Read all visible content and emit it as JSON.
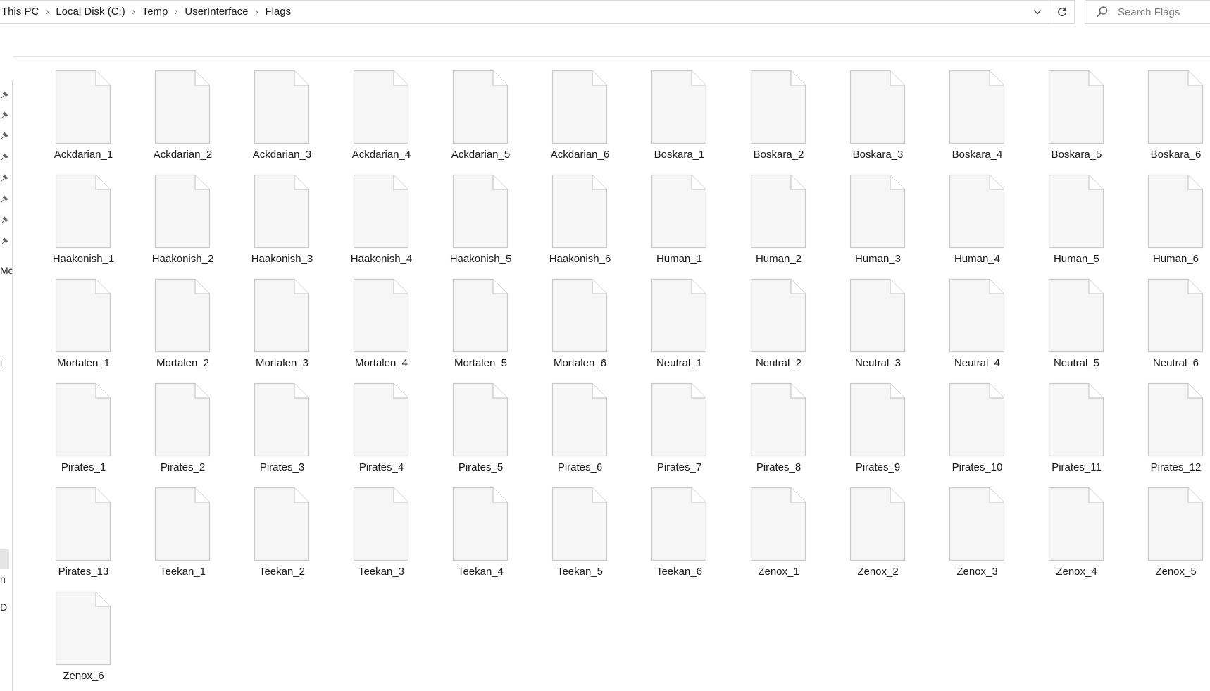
{
  "breadcrumb": [
    "This PC",
    "Local Disk (C:)",
    "Temp",
    "UserInterface",
    "Flags"
  ],
  "search": {
    "placeholder": "Search Flags",
    "value": ""
  },
  "nav_fragments": [
    "Mc",
    "l",
    "n",
    "D"
  ],
  "icons": {
    "dropdown": "chevron-down-icon",
    "refresh": "refresh-icon",
    "search": "search-icon",
    "file": "blank-file-icon",
    "pin": "pin-icon"
  },
  "files": [
    "Ackdarian_1",
    "Ackdarian_2",
    "Ackdarian_3",
    "Ackdarian_4",
    "Ackdarian_5",
    "Ackdarian_6",
    "Boskara_1",
    "Boskara_2",
    "Boskara_3",
    "Boskara_4",
    "Boskara_5",
    "Boskara_6",
    "Haakonish_1",
    "Haakonish_2",
    "Haakonish_3",
    "Haakonish_4",
    "Haakonish_5",
    "Haakonish_6",
    "Human_1",
    "Human_2",
    "Human_3",
    "Human_4",
    "Human_5",
    "Human_6",
    "Mortalen_1",
    "Mortalen_2",
    "Mortalen_3",
    "Mortalen_4",
    "Mortalen_5",
    "Mortalen_6",
    "Neutral_1",
    "Neutral_2",
    "Neutral_3",
    "Neutral_4",
    "Neutral_5",
    "Neutral_6",
    "Pirates_1",
    "Pirates_2",
    "Pirates_3",
    "Pirates_4",
    "Pirates_5",
    "Pirates_6",
    "Pirates_7",
    "Pirates_8",
    "Pirates_9",
    "Pirates_10",
    "Pirates_11",
    "Pirates_12",
    "Pirates_13",
    "Teekan_1",
    "Teekan_2",
    "Teekan_3",
    "Teekan_4",
    "Teekan_5",
    "Teekan_6",
    "Zenox_1",
    "Zenox_2",
    "Zenox_3",
    "Zenox_4",
    "Zenox_5",
    "Zenox_6"
  ]
}
